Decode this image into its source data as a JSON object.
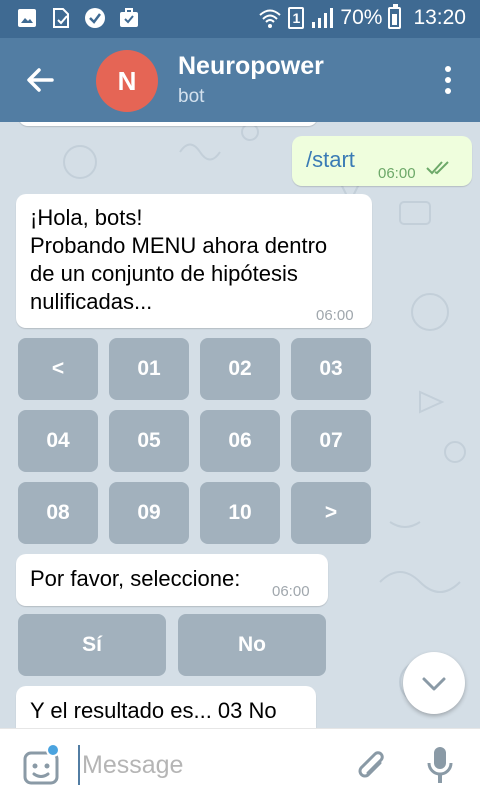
{
  "status_bar": {
    "battery": "70%",
    "time": "13:20",
    "sim": "1"
  },
  "header": {
    "avatar_letter": "N",
    "title": "Neuropower",
    "subtitle": "bot"
  },
  "messages": {
    "start": {
      "text": "/start",
      "time": "06:00"
    },
    "hola": {
      "line1": "¡Hola, bots!",
      "line2": "Probando MENU ahora dentro",
      "line3": "de un conjunto de hipótesis",
      "line4": "nulificadas...",
      "time": "06:00"
    },
    "favor": {
      "text": "Por favor, seleccione:",
      "time": "06:00"
    },
    "resultado": {
      "text": "Y el resultado es... 03 No"
    }
  },
  "keyboard1": {
    "row1": [
      "<",
      "01",
      "02",
      "03"
    ],
    "row2": [
      "04",
      "05",
      "06",
      "07"
    ],
    "row3": [
      "08",
      "09",
      "10",
      ">"
    ]
  },
  "keyboard2": [
    "Sí",
    "No"
  ],
  "input": {
    "placeholder": "Message"
  },
  "colors": {
    "header": "#527da3",
    "status_bar": "#3f6a92",
    "avatar": "#e56555",
    "outgoing_bubble": "#effedd",
    "chat_background": "#d4dee6"
  }
}
